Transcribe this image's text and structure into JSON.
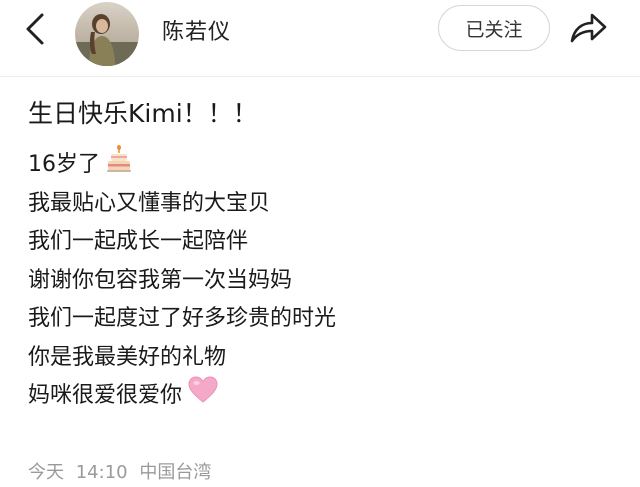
{
  "header": {
    "back_icon": "chevron-left-icon",
    "username": "陈若仪",
    "follow_label": "已关注",
    "share_icon": "share-arrow-icon"
  },
  "post": {
    "title": "生日快乐Kimi！！！",
    "lines": [
      {
        "text": "16岁了",
        "emoji": "birthday-cake-icon"
      },
      {
        "text": "我最贴心又懂事的大宝贝"
      },
      {
        "text": "我们一起成长一起陪伴"
      },
      {
        "text": "谢谢你包容我第一次当妈妈"
      },
      {
        "text": "我们一起度过了好多珍贵的时光"
      },
      {
        "text": "你是我最美好的礼物"
      },
      {
        "text": "妈咪很爱很爱你",
        "emoji": "pink-heart-icon"
      }
    ]
  },
  "meta": {
    "day": "今天",
    "time": "14:10",
    "location": "中国台湾"
  },
  "colors": {
    "text": "#1a1a1a",
    "meta": "#9a9a9a",
    "heart": "#f5a9c8",
    "border": "#d6d6d6"
  }
}
